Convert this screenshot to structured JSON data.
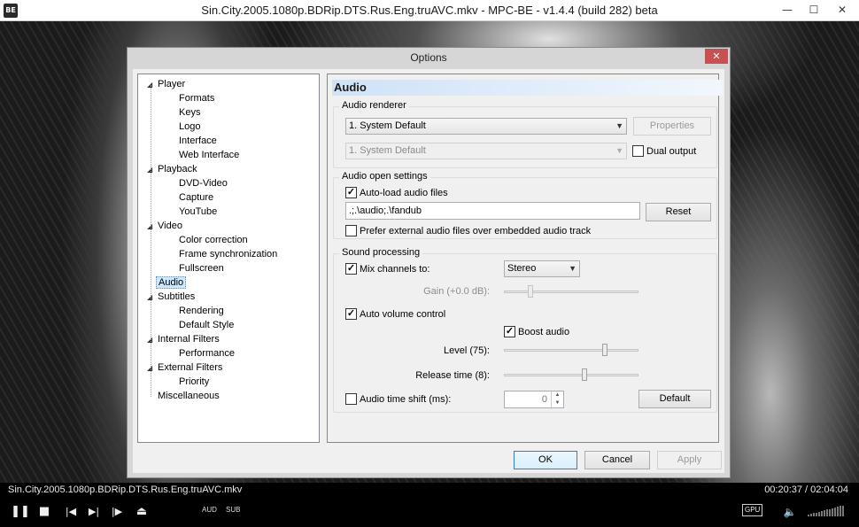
{
  "window": {
    "title": "Sin.City.2005.1080p.BDRip.DTS.Rus.Eng.truAVC.mkv - MPC-BE - v1.4.4 (build 282) beta",
    "app_icon": "BE",
    "minimize_icon": "—",
    "maximize_icon": "☐",
    "close_icon": "✕"
  },
  "dialog": {
    "title": "Options",
    "close_icon": "✕"
  },
  "tree": {
    "items": [
      {
        "label": "Player",
        "expanded": true
      },
      {
        "label": "Formats"
      },
      {
        "label": "Keys"
      },
      {
        "label": "Logo"
      },
      {
        "label": "Interface"
      },
      {
        "label": "Web Interface"
      },
      {
        "label": "Playback",
        "expanded": true
      },
      {
        "label": "DVD-Video"
      },
      {
        "label": "Capture"
      },
      {
        "label": "YouTube"
      },
      {
        "label": "Video",
        "expanded": true
      },
      {
        "label": "Color correction"
      },
      {
        "label": "Frame synchronization"
      },
      {
        "label": "Fullscreen"
      },
      {
        "label": "Audio",
        "selected": true
      },
      {
        "label": "Subtitles",
        "expanded": true
      },
      {
        "label": "Rendering"
      },
      {
        "label": "Default Style"
      },
      {
        "label": "Internal Filters",
        "expanded": true
      },
      {
        "label": "Performance"
      },
      {
        "label": "External Filters",
        "expanded": true
      },
      {
        "label": "Priority"
      },
      {
        "label": "Miscellaneous"
      }
    ]
  },
  "page": {
    "header": "Audio",
    "audio_renderer": {
      "group_label": "Audio renderer",
      "renderer_value": "1. System Default",
      "properties_button": "Properties",
      "second_renderer_value": "1. System Default",
      "dual_output_label": "Dual output",
      "dual_output_checked": false
    },
    "audio_open": {
      "group_label": "Audio open settings",
      "autoload_label": "Auto-load audio files",
      "autoload_checked": true,
      "paths_value": ".;.\\audio;.\\fandub",
      "reset_button": "Reset",
      "prefer_external_label": "Prefer external audio files over embedded audio track",
      "prefer_external_checked": false
    },
    "sound_processing": {
      "group_label": "Sound processing",
      "mix_channels_label": "Mix channels to:",
      "mix_channels_checked": true,
      "mix_value": "Stereo",
      "gain_label": "Gain (+0.0 dB):",
      "gain_level": 0.2,
      "auto_volume_label": "Auto volume control",
      "auto_volume_checked": true,
      "boost_label": "Boost audio",
      "boost_checked": true,
      "level_label": "Level (75):",
      "level_value": 0.75,
      "release_label": "Release time (8):",
      "release_value": 0.6,
      "time_shift_label": "Audio time shift (ms):",
      "time_shift_checked": false,
      "time_shift_value": "0",
      "default_button": "Default"
    }
  },
  "footer": {
    "ok": "OK",
    "cancel": "Cancel",
    "apply": "Apply"
  },
  "status": {
    "filename": "Sin.City.2005.1080p.BDRip.DTS.Rus.Eng.truAVC.mkv",
    "time": "00:20:37 / 02:04:04"
  },
  "controls": {
    "play_icon": "❚❚",
    "stop_icon": "■",
    "prev_icon": "|◀",
    "next_icon": "▶|",
    "frame_step_icon": "|▶",
    "eject_icon": "⏏",
    "aud": "AUD",
    "sub": "SUB",
    "gpu": "GPU",
    "mute_icon": "🔈",
    "volume": 0.0
  }
}
